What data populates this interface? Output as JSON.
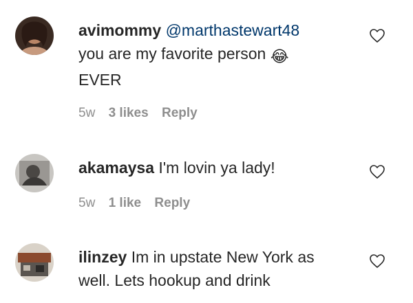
{
  "comments": [
    {
      "username": "avimommy",
      "mention": "@marthastewart48",
      "text_line1": "you are my favorite person",
      "emoji": "😂",
      "text_line2": "EVER",
      "time": "5w",
      "likes": "3 likes",
      "reply": "Reply"
    },
    {
      "username": "akamaysa",
      "text": "I'm lovin ya lady!",
      "time": "5w",
      "likes": "1 like",
      "reply": "Reply"
    },
    {
      "username": "ilinzey",
      "text_line1": "Im in upstate New York as",
      "text_line2": "well. Lets hookup and drink"
    }
  ],
  "icons": {
    "like": "heart-outline-icon",
    "avatar_1": "avatar-avimommy",
    "avatar_2": "avatar-akamaysa",
    "avatar_3": "avatar-ilinzey"
  },
  "colors": {
    "text": "#262626",
    "meta": "#8e8e8e",
    "mention": "#00376b"
  }
}
